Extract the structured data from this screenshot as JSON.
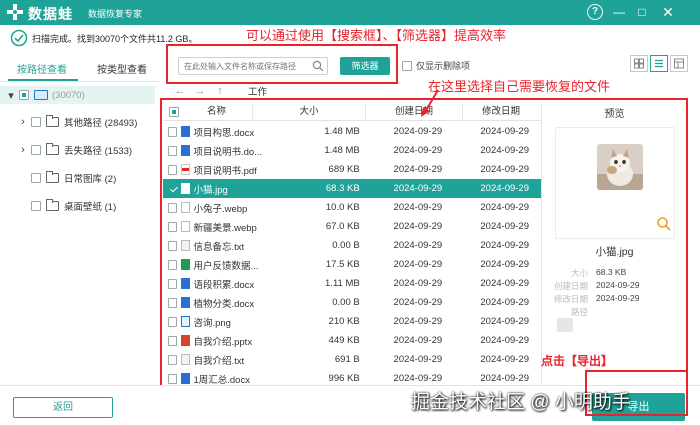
{
  "app": {
    "name": "数据蛙",
    "subtitle": "数据恢复专家"
  },
  "window": {
    "help": "?",
    "minimize": "—",
    "maximize": "□",
    "close": "✕"
  },
  "scan": {
    "status": "扫描完成。找到30070个文件共11.2 GB。"
  },
  "search": {
    "placeholder": "在此处输入文件名称或保存路径",
    "filter_label": "筛选器",
    "show_deleted_label": "仅显示删除项",
    "show_deleted_checked": false
  },
  "sidebar": {
    "tabs": [
      {
        "label": "按路径查看",
        "active": true
      },
      {
        "label": "按类型查看",
        "active": false
      }
    ],
    "root": {
      "label": "",
      "count": "(30070)"
    },
    "items": [
      {
        "label": "其他路径 (28493)",
        "expandable": true
      },
      {
        "label": "丢失路径 (1533)",
        "expandable": true
      },
      {
        "label": "日常图库 (2)",
        "expandable": false
      },
      {
        "label": "桌面壁纸 (1)",
        "expandable": false
      }
    ]
  },
  "nav": {
    "back": "←",
    "forward": "→",
    "up": "↑",
    "path": "工作"
  },
  "table": {
    "columns": [
      "名称",
      "大小",
      "创建日期",
      "修改日期"
    ],
    "rows": [
      {
        "name": "项目构思.docx",
        "size": "1.48 MB",
        "created": "2024-09-29",
        "modified": "2024-09-29",
        "type": "docx",
        "checked": false
      },
      {
        "name": "项目说明书.do...",
        "size": "1.48 MB",
        "created": "2024-09-29",
        "modified": "2024-09-29",
        "type": "docx",
        "checked": false
      },
      {
        "name": "项目说明书.pdf",
        "size": "689 KB",
        "created": "2024-09-29",
        "modified": "2024-09-29",
        "type": "pdf",
        "checked": false
      },
      {
        "name": "小猫.jpg",
        "size": "68.3 KB",
        "created": "2024-09-29",
        "modified": "2024-09-29",
        "type": "jpg",
        "checked": true
      },
      {
        "name": "小兔子.webp",
        "size": "10.0 KB",
        "created": "2024-09-29",
        "modified": "2024-09-29",
        "type": "webp",
        "checked": false
      },
      {
        "name": "新疆美景.webp",
        "size": "67.0 KB",
        "created": "2024-09-29",
        "modified": "2024-09-29",
        "type": "webp",
        "checked": false
      },
      {
        "name": "信息备忘.txt",
        "size": "0.00 B",
        "created": "2024-09-29",
        "modified": "2024-09-29",
        "type": "txt",
        "checked": false
      },
      {
        "name": "用户反馈数据...",
        "size": "17.5 KB",
        "created": "2024-09-29",
        "modified": "2024-09-29",
        "type": "xlsx",
        "checked": false
      },
      {
        "name": "语段积累.docx",
        "size": "1.11 MB",
        "created": "2024-09-29",
        "modified": "2024-09-29",
        "type": "docx",
        "checked": false
      },
      {
        "name": "植物分类.docx",
        "size": "0.00 B",
        "created": "2024-09-29",
        "modified": "2024-09-29",
        "type": "docx",
        "checked": false
      },
      {
        "name": "咨询.png",
        "size": "210 KB",
        "created": "2024-09-29",
        "modified": "2024-09-29",
        "type": "png",
        "checked": false
      },
      {
        "name": "自我介绍.pptx",
        "size": "449 KB",
        "created": "2024-09-29",
        "modified": "2024-09-29",
        "type": "pptx",
        "checked": false
      },
      {
        "name": "自我介绍.txt",
        "size": "691 B",
        "created": "2024-09-29",
        "modified": "2024-09-29",
        "type": "txt",
        "checked": false
      },
      {
        "name": "1周汇总.docx",
        "size": "996 KB",
        "created": "2024-09-29",
        "modified": "2024-09-29",
        "type": "docx",
        "checked": false
      }
    ],
    "selected_index": 3
  },
  "preview": {
    "title": "预览",
    "file_name": "小猫.jpg",
    "meta": [
      {
        "key": "大小",
        "value": "68.3 KB"
      },
      {
        "key": "创建日期",
        "value": "2024-09-29"
      },
      {
        "key": "修改日期",
        "value": "2024-09-29"
      },
      {
        "key": "路径",
        "value": ""
      }
    ]
  },
  "footer": {
    "back_label": "返回",
    "export_label": "导出"
  },
  "annotations": {
    "top": "可以通过使用【搜索框】、【筛选器】提高效率",
    "middle": "在这里选择自己需要恢复的文件",
    "bottom": "点击【导出】"
  },
  "watermark": "掘金技术社区 @ 小明助手",
  "colors": {
    "accent": "#1fa398",
    "annotation": "#e8232b"
  }
}
